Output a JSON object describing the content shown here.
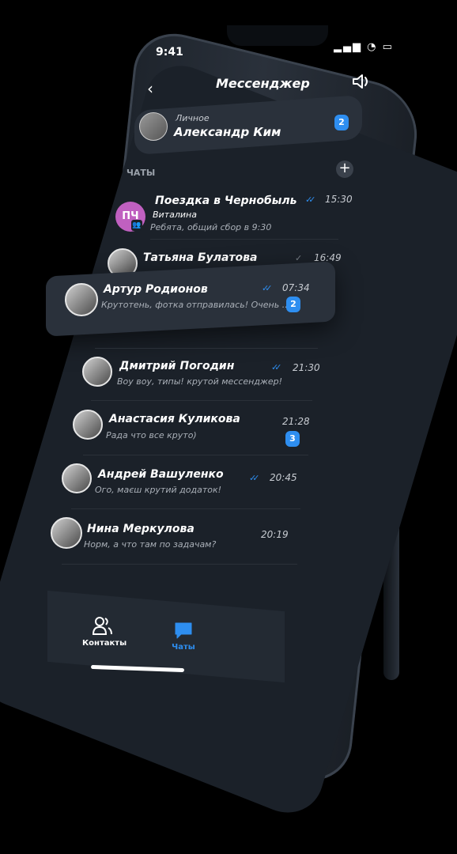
{
  "status": {
    "time": "9:41",
    "icons_text": "▂▄▆ ◔ ▭"
  },
  "header": {
    "title": "Мессенджер"
  },
  "personal": {
    "label": "Личное",
    "name": "Александр Ким",
    "badge": "2"
  },
  "chats_section": {
    "label": "ЧАТЫ"
  },
  "chats": [
    {
      "name": "Поездка в Чернобыль",
      "sender": "Виталина",
      "message": "Ребята, общий сбор в 9:30",
      "time": "15:30",
      "avatar_initials": "ПЧ",
      "read": "double"
    },
    {
      "name": "Татьяна Булатова",
      "message": "",
      "time": "16:49",
      "read": "single"
    },
    {
      "name": "Артур Родионов",
      "message": "Крутотень, фотка отправилась! Очень ...",
      "time": "07:34",
      "badge": "2",
      "read": "double"
    },
    {
      "name": "Дмитрий Погодин",
      "message": "Воу воу, типы! крутой мессенджер!",
      "time": "21:30",
      "read": "double"
    },
    {
      "name": "Анастасия Куликова",
      "message": "Рада что все круто)",
      "time": "21:28",
      "badge": "3"
    },
    {
      "name": "Андрей Вашуленко",
      "message": "Ого, маєш крутий додаток!",
      "time": "20:45",
      "read": "double"
    },
    {
      "name": "Нина Меркулова",
      "message": "Норм, а что там по задачам?",
      "time": "20:19"
    }
  ],
  "tabs": [
    {
      "label": "Контакты",
      "icon": "contacts-icon",
      "active": false
    },
    {
      "label": "Чаты",
      "icon": "chat-bubble-icon",
      "active": true
    }
  ],
  "colors": {
    "accent": "#2e8ef0",
    "screen_bg": "#1b2129",
    "card_bg": "#2a313b"
  }
}
